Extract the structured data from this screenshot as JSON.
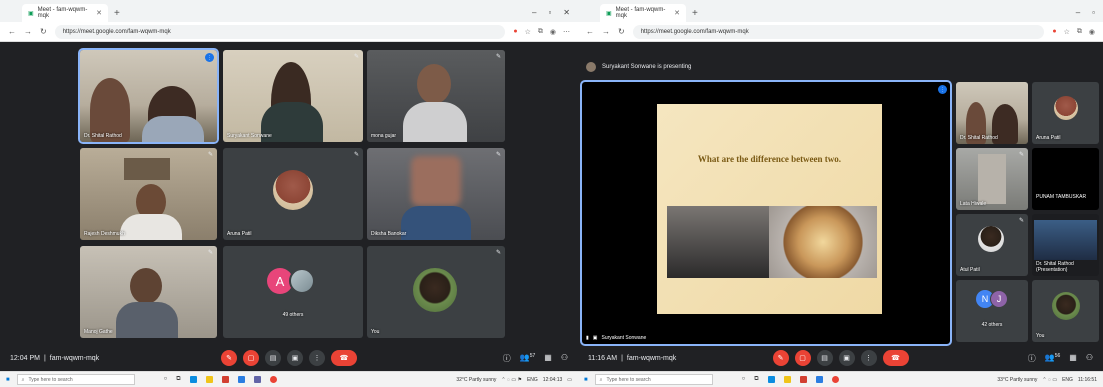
{
  "left": {
    "tab_title": "Meet - fam-wqwm-mqk",
    "url": "https://meet.google.com/fam-wqwm-mqk",
    "tiles": [
      {
        "name": "Dr. Shital Rathod"
      },
      {
        "name": "Suryakant Sonwane"
      },
      {
        "name": "mona gujar"
      },
      {
        "name": "Rajesh Deshmukh"
      },
      {
        "name": "Aruna Patil"
      },
      {
        "name": "Diksha Banokar"
      },
      {
        "name": "Manoj Gathe"
      },
      {
        "name": "49 others",
        "avatar_letter": "A"
      },
      {
        "name": "You"
      }
    ],
    "time": "12:04 PM",
    "meeting_code": "fam-wqwm-mqk",
    "participants_badge": "57",
    "taskbar": {
      "search_placeholder": "Type here to search",
      "weather": "32°C Partly sunny",
      "lang": "ENG",
      "clock": "12:04:13"
    }
  },
  "right": {
    "tab_title": "Meet - fam-wqwm-mqk",
    "url": "https://meet.google.com/fam-wqwm-mqk",
    "presenting_banner": "Suryakant Sonwane is presenting",
    "presenter_label": "Suryakant Sonwane",
    "slide_title": "What are the difference between two.",
    "tiles": [
      {
        "name": "Dr. Shital Rathod"
      },
      {
        "name": "Aruna Patil"
      },
      {
        "name": "Lata Hiwale"
      },
      {
        "name": "PUNAM TAMBUSKAR"
      },
      {
        "name": "Atul Patil"
      },
      {
        "name": "Dr. Shital Rathod (Presentation)"
      },
      {
        "name": "42 others",
        "avatars": [
          "N",
          "J"
        ]
      },
      {
        "name": "You"
      }
    ],
    "time": "11:16 AM",
    "meeting_code": "fam-wqwm-mqk",
    "participants_badge": "56",
    "taskbar": {
      "search_placeholder": "Type here to search",
      "weather": "33°C Partly sunny",
      "lang": "ENG",
      "clock": "11:16:51"
    }
  },
  "colors": {
    "meet_bg": "#202124",
    "tile_bg": "#3c4043",
    "red": "#ea4335",
    "accent": "#8ab4f8"
  }
}
